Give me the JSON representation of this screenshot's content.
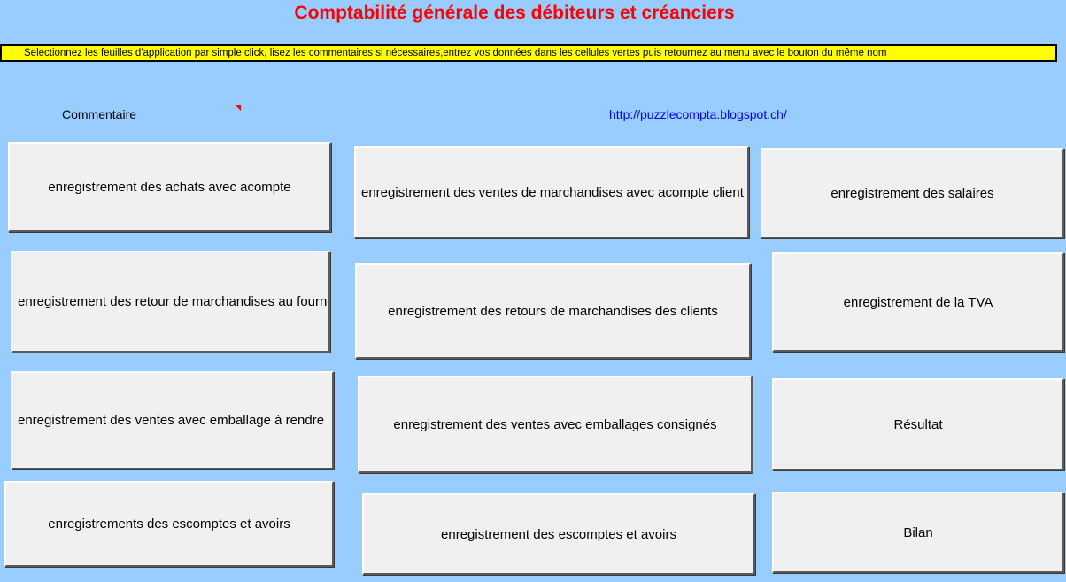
{
  "title": "Comptabilité générale des débiteurs et créanciers",
  "instruction": "Selectionnez les feuilles d'application  par simple click, lisez les commentaires si nécessaires,entrez vos données dans les cellules vertes puis retournez au menu avec le bouton du même nom",
  "comment_label": "Commentaire",
  "link": "http://puzzlecompta.blogspot.ch/",
  "buttons": {
    "achats_acompte": "enregistrement des achats avec acompte",
    "retour_fournisseurs": "enregistrement des retour de marchandises au fournisseurs",
    "ventes_emballage_rendre": "enregistrement des ventes avec emballage à rendre",
    "escomptes_avoirs_1": "enregistrements des escomptes et avoirs",
    "ventes_acompte": "enregistrement des ventes de marchandises avec acompte client",
    "retours_clients": "enregistrement des retours de marchandises des clients",
    "ventes_emballages_consignes": "enregistrement des ventes avec emballages consignés",
    "escomptes_avoirs_2": "enregistrement des escomptes et avoirs",
    "salaires": "enregistrement des salaires",
    "tva": "enregistrement de la TVA",
    "resultat": "Résultat",
    "bilan": "Bilan"
  }
}
